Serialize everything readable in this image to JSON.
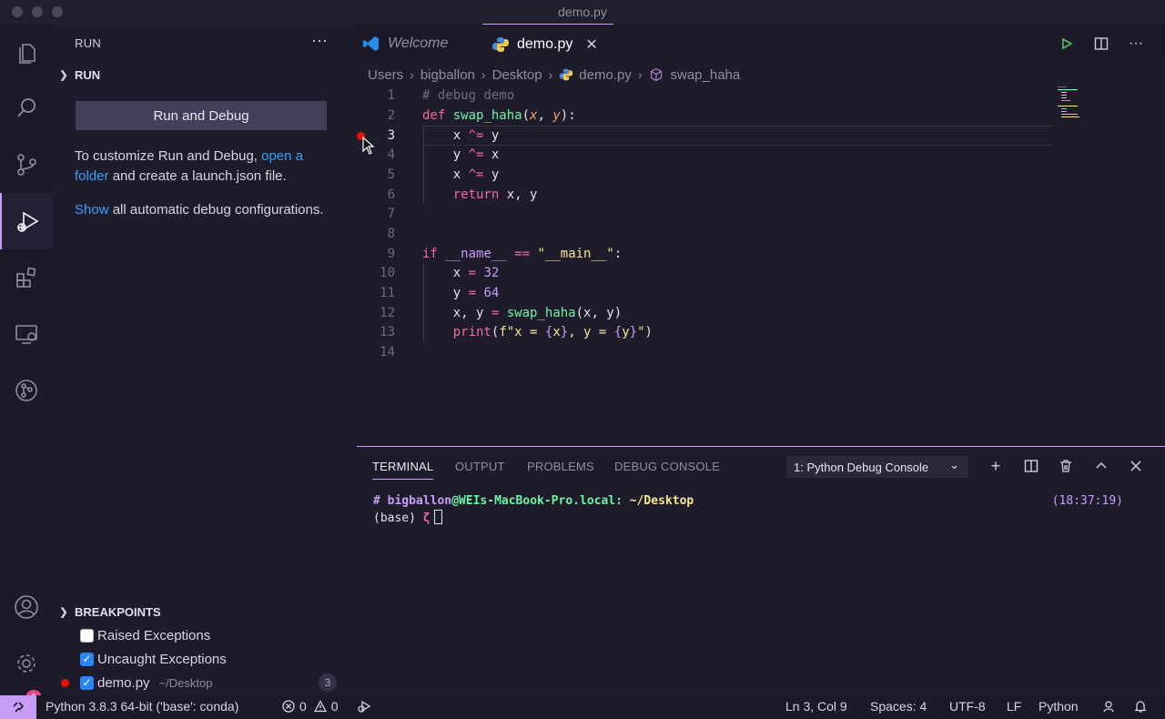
{
  "window": {
    "title": "demo.py"
  },
  "activity_bar": {
    "account_badge": "1"
  },
  "sidebar": {
    "title": "RUN",
    "section_title": "RUN",
    "run_button": "Run and Debug",
    "customize_text_1": "To customize Run and Debug,",
    "customize_link": "open a folder",
    "customize_text_2": "and create a launch.json file.",
    "show_link": "Show",
    "show_text": "all automatic debug configurations.",
    "breakpoints": {
      "title": "BREAKPOINTS",
      "items": [
        {
          "label": "Raised Exceptions",
          "checked": false
        },
        {
          "label": "Uncaught Exceptions",
          "checked": true
        },
        {
          "label": "demo.py",
          "checked": true,
          "path": "~/Desktop",
          "count": "3"
        }
      ]
    }
  },
  "tabs": [
    {
      "label": "Welcome",
      "active": false
    },
    {
      "label": "demo.py",
      "active": true
    }
  ],
  "breadcrumbs": [
    "Users",
    "bigballon",
    "Desktop",
    "demo.py",
    "swap_haha"
  ],
  "editor": {
    "line_numbers": [
      "1",
      "2",
      "3",
      "4",
      "5",
      "6",
      "7",
      "8",
      "9",
      "10",
      "11",
      "12",
      "13",
      "14"
    ],
    "lines": [
      "# debug demo",
      "def swap_haha(x, y):",
      "    x ^= y",
      "    y ^= x",
      "    x ^= y",
      "    return x, y",
      "",
      "",
      "if __name__ == \"__main__\":",
      "    x = 32",
      "    y = 64",
      "    x, y = swap_haha(x, y)",
      "    print(f\"x = {x}, y = {y}\")",
      ""
    ]
  },
  "panel": {
    "tabs": [
      "TERMINAL",
      "OUTPUT",
      "PROBLEMS",
      "DEBUG CONSOLE"
    ],
    "terminal_select": "1: Python Debug Console",
    "prompt_hash": "#",
    "prompt_user": "bigballon",
    "prompt_host": "@WEIs-MacBook-Pro.local:",
    "prompt_dir": "~/Desktop",
    "prompt_time": "(18:37:19)",
    "prompt_env": "(base)",
    "prompt_symbol": "ζ"
  },
  "statusbar": {
    "python": "Python 3.8.3 64-bit ('base': conda)",
    "errors": "0",
    "warnings": "0",
    "position": "Ln 3, Col 9",
    "spaces": "Spaces: 4",
    "encoding": "UTF-8",
    "eol": "LF",
    "language": "Python"
  },
  "colors": {
    "accent": "#c79df7",
    "link": "#3c9ff5",
    "breakpoint": "#e51400"
  }
}
